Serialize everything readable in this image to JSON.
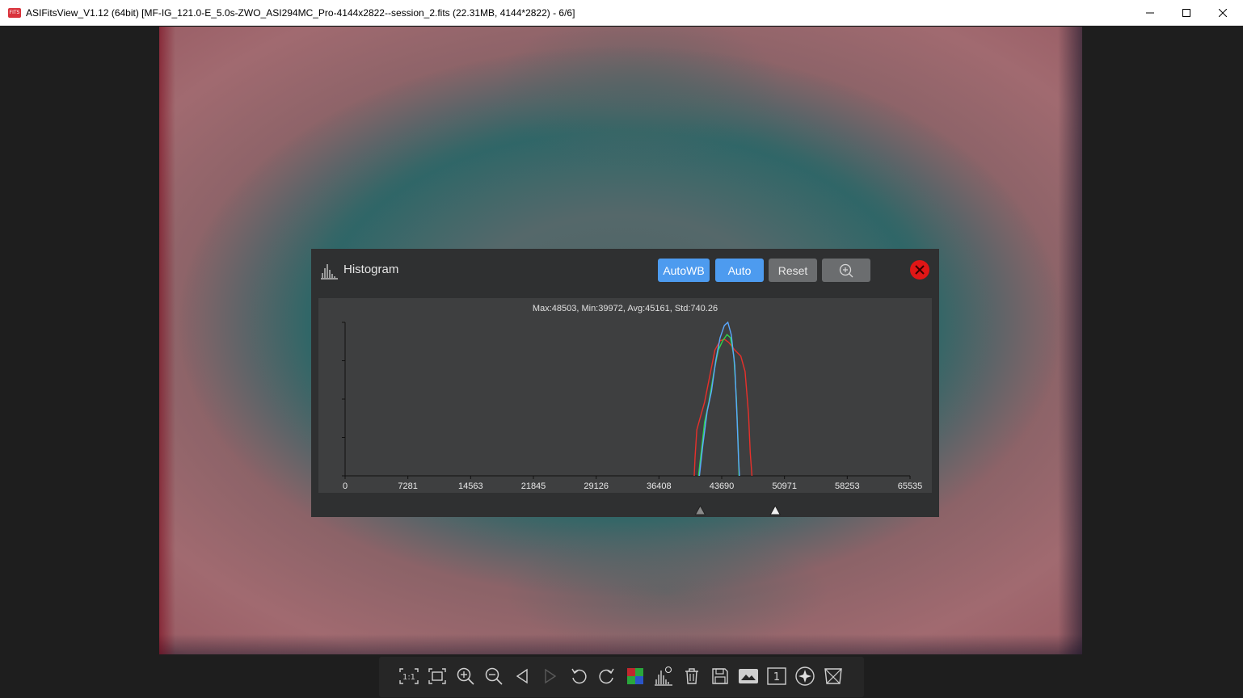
{
  "window": {
    "title": "ASIFitsView_V1.12 (64bit) [MF-IG_121.0-E_5.0s-ZWO_ASI294MC_Pro-4144x2822--session_2.fits (22.31MB, 4144*2822) - 6/6]",
    "app_icon_text": "FITS",
    "controls": [
      "minimize",
      "maximize",
      "close"
    ]
  },
  "histogram": {
    "title": "Histogram",
    "buttons": {
      "autowb": "AutoWB",
      "auto": "Auto",
      "reset": "Reset",
      "zoom_icon": "zoom-in-icon"
    },
    "stats": "Max:48503, Min:39972, Avg:45161, Std:740.26",
    "slider_low": 41200,
    "slider_high": 49900
  },
  "chart_data": {
    "type": "line",
    "xlim": [
      0,
      65535
    ],
    "x_ticks": [
      "0",
      "7281",
      "14563",
      "21845",
      "29126",
      "36408",
      "43690",
      "50971",
      "58253",
      "65535"
    ],
    "ylim": [
      0,
      1
    ],
    "y_axis_labels": false,
    "series": [
      {
        "color": "#e8302a",
        "points": [
          [
            40500,
            0
          ],
          [
            40600,
            0.12
          ],
          [
            40800,
            0.3
          ],
          [
            41200,
            0.38
          ],
          [
            41700,
            0.48
          ],
          [
            42300,
            0.65
          ],
          [
            42900,
            0.82
          ],
          [
            43500,
            0.88
          ],
          [
            44000,
            0.89
          ],
          [
            44500,
            0.87
          ],
          [
            45200,
            0.82
          ],
          [
            45900,
            0.78
          ],
          [
            46400,
            0.68
          ],
          [
            46800,
            0.4
          ],
          [
            47000,
            0.15
          ],
          [
            47200,
            0
          ]
        ]
      },
      {
        "color": "#2fd44a",
        "points": [
          [
            41000,
            0
          ],
          [
            41300,
            0.15
          ],
          [
            41700,
            0.35
          ],
          [
            42200,
            0.48
          ],
          [
            42800,
            0.68
          ],
          [
            43300,
            0.82
          ],
          [
            43800,
            0.88
          ],
          [
            44300,
            0.92
          ],
          [
            44700,
            0.9
          ],
          [
            45100,
            0.78
          ],
          [
            45400,
            0.5
          ],
          [
            45600,
            0.2
          ],
          [
            45700,
            0
          ]
        ]
      },
      {
        "color": "#5aa8ff",
        "points": [
          [
            41100,
            0
          ],
          [
            41500,
            0.2
          ],
          [
            42000,
            0.42
          ],
          [
            42500,
            0.55
          ],
          [
            43000,
            0.75
          ],
          [
            43500,
            0.9
          ],
          [
            44000,
            0.98
          ],
          [
            44400,
            1.0
          ],
          [
            44800,
            0.92
          ],
          [
            45200,
            0.72
          ],
          [
            45450,
            0.4
          ],
          [
            45650,
            0.1
          ],
          [
            45750,
            0
          ]
        ]
      }
    ]
  },
  "toolbar": {
    "items": [
      {
        "name": "actual-size-icon",
        "label": "1:1"
      },
      {
        "name": "fit-window-icon"
      },
      {
        "name": "zoom-in-icon"
      },
      {
        "name": "zoom-out-icon"
      },
      {
        "name": "previous-icon"
      },
      {
        "name": "next-icon"
      },
      {
        "name": "rotate-left-icon"
      },
      {
        "name": "rotate-right-icon"
      },
      {
        "name": "debayer-icon"
      },
      {
        "name": "histogram-icon"
      },
      {
        "name": "delete-icon"
      },
      {
        "name": "save-icon"
      },
      {
        "name": "image-info-icon"
      },
      {
        "name": "single-frame-icon",
        "label": "1"
      },
      {
        "name": "star-detect-icon"
      },
      {
        "name": "crop-icon"
      }
    ]
  }
}
